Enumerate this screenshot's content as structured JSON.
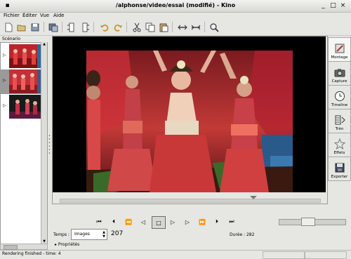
{
  "window": {
    "title": "/alphonse/video/essai (modifié) - Kino",
    "controls": [
      "minimize-icon",
      "maximize-icon",
      "close-icon"
    ]
  },
  "menu": [
    "Fichier",
    "Éditer",
    "Vue",
    "Aide"
  ],
  "toolbar": {
    "tools": [
      {
        "name": "new-icon"
      },
      {
        "name": "open-icon"
      },
      {
        "name": "save-icon"
      },
      {
        "name": "save-frame-icon"
      },
      {
        "name": "cut-scene-icon"
      },
      {
        "name": "insert-scene-icon"
      },
      {
        "name": "undo-icon"
      },
      {
        "name": "redo-icon"
      },
      {
        "name": "cut-icon"
      },
      {
        "name": "copy-icon"
      },
      {
        "name": "paste-icon"
      },
      {
        "name": "split-icon"
      },
      {
        "name": "join-icon"
      },
      {
        "name": "zoom-icon"
      }
    ]
  },
  "storyboard": {
    "label": "Scénario",
    "scenes": [
      {
        "selected": false
      },
      {
        "selected": true
      },
      {
        "selected": false
      }
    ]
  },
  "sidebar": {
    "buttons": [
      {
        "label": "Montage",
        "active": true
      },
      {
        "label": "Capture",
        "active": false
      },
      {
        "label": "Timeline",
        "active": false
      },
      {
        "label": "Trim",
        "active": false
      },
      {
        "label": "Effets",
        "active": false
      },
      {
        "label": "Exporter",
        "active": false
      }
    ]
  },
  "transport": [
    {
      "name": "start-icon",
      "glyph": "⏮"
    },
    {
      "name": "prev-scene-icon",
      "glyph": "⏴"
    },
    {
      "name": "rewind-icon",
      "glyph": "⏪"
    },
    {
      "name": "back-frame-icon",
      "glyph": "◁"
    },
    {
      "name": "stop-icon",
      "glyph": "□",
      "pressed": true
    },
    {
      "name": "play-icon",
      "glyph": "▷"
    },
    {
      "name": "forward-frame-icon",
      "glyph": "▷"
    },
    {
      "name": "fast-forward-icon",
      "glyph": "⏩"
    },
    {
      "name": "next-scene-icon",
      "glyph": "⏵"
    },
    {
      "name": "end-icon",
      "glyph": "⏭"
    }
  ],
  "position": {
    "label": "Temps :",
    "units": "Images",
    "frame": "207",
    "duration": "Durée : 282"
  },
  "volume": {
    "level": 0.42
  },
  "properties_label": "Propriétés",
  "status": "Rendering finished - time: 4"
}
